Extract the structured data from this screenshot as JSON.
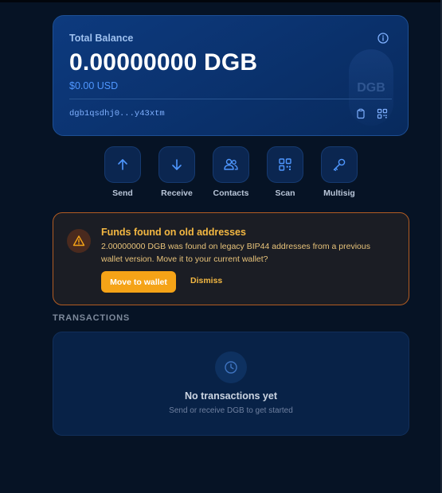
{
  "balance": {
    "label": "Total Balance",
    "amount": "0.00000000 DGB",
    "fiat": "$0.00 USD",
    "address": "dgb1qsdhj0...y43xtm",
    "watermark": "DGB"
  },
  "actions": [
    {
      "label": "Send",
      "icon": "arrow-up-icon"
    },
    {
      "label": "Receive",
      "icon": "arrow-down-icon"
    },
    {
      "label": "Contacts",
      "icon": "contacts-icon"
    },
    {
      "label": "Scan",
      "icon": "scan-icon"
    },
    {
      "label": "Multisig",
      "icon": "key-icon"
    }
  ],
  "warning": {
    "title": "Funds found on old addresses",
    "description": "2.00000000 DGB was found on legacy BIP44 addresses from a previous wallet version. Move it to your current wallet?",
    "primary_label": "Move to wallet",
    "secondary_label": "Dismiss",
    "icon": "warning-icon"
  },
  "transactions": {
    "heading": "TRANSACTIONS",
    "empty_title": "No transactions yet",
    "empty_subtitle": "Send or receive DGB to get started",
    "icon": "clock-icon"
  },
  "colors": {
    "background": "#061325",
    "accent": "#4f97ff",
    "warning": "#f5a317",
    "card": "#0b3370"
  }
}
